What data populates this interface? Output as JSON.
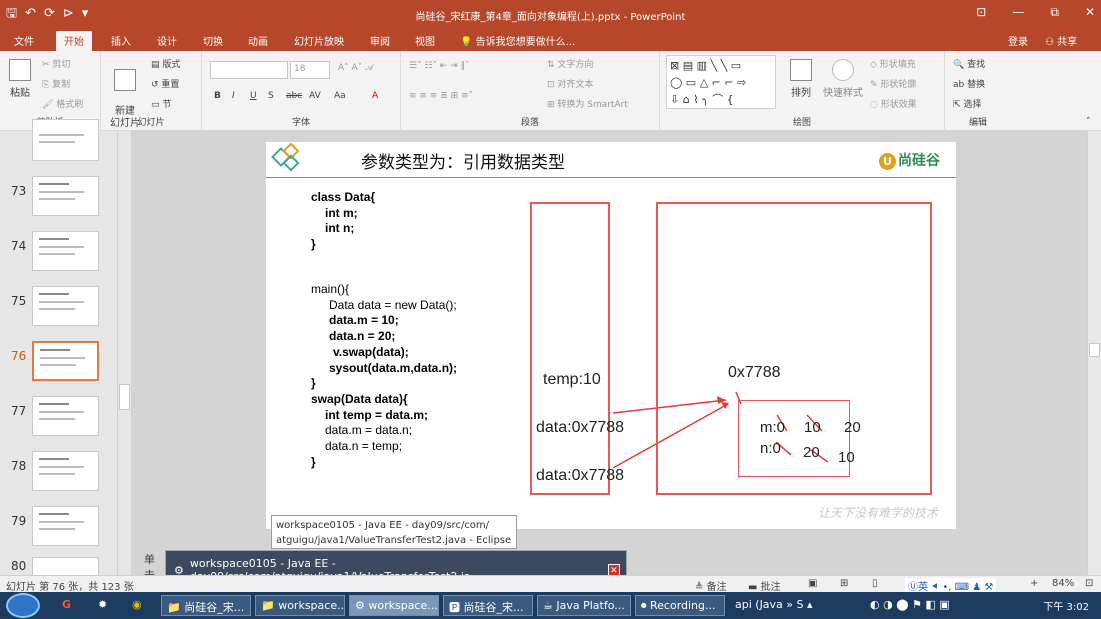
{
  "titlebar": {
    "qat": [
      "🖫",
      "↶",
      "⟳",
      "⊳",
      "▾"
    ],
    "title": "尚硅谷_宋红康_第4章_面向对象编程(上).pptx - PowerPoint",
    "win_controls": [
      "⊡",
      "—",
      "⧉",
      "✕"
    ]
  },
  "tabs": [
    "文件",
    "开始",
    "插入",
    "设计",
    "切换",
    "动画",
    "幻灯片放映",
    "审阅",
    "视图"
  ],
  "tellme": "告诉我您想要做什么...",
  "login": "登录",
  "share": "共享",
  "ribbon": {
    "clipboard": {
      "label": "剪贴板",
      "paste": "粘贴",
      "cut": "剪切",
      "copy": "复制",
      "format_painter": "格式刷"
    },
    "slides": {
      "label": "幻灯片",
      "new_slide": "新建\n幻灯片",
      "layout": "版式",
      "reset": "重置",
      "section": "节"
    },
    "font": {
      "label": "字体",
      "font_name": "",
      "font_size": "18",
      "buttons": [
        "B",
        "I",
        "U",
        "S",
        "abc",
        "AV",
        "Aa",
        "A"
      ]
    },
    "paragraph": {
      "label": "段落",
      "text_direction": "文字方向",
      "align_text": "对齐文本",
      "smartart": "转换为 SmartArt"
    },
    "drawing": {
      "label": "绘图",
      "arrange": "排列",
      "quick_styles": "快速样式",
      "shape_fill": "形状填充",
      "shape_outline": "形状轮廓",
      "shape_effects": "形状效果"
    },
    "editing": {
      "label": "编辑",
      "find": "查找",
      "replace": "替换",
      "select": "选择"
    }
  },
  "thumbnails": [
    {
      "num": "",
      "active": false
    },
    {
      "num": "73",
      "active": false
    },
    {
      "num": "74",
      "active": false
    },
    {
      "num": "75",
      "active": false
    },
    {
      "num": "76",
      "active": true
    },
    {
      "num": "77",
      "active": false
    },
    {
      "num": "78",
      "active": false
    },
    {
      "num": "79",
      "active": false
    },
    {
      "num": "80",
      "active": false
    }
  ],
  "slide": {
    "title": "参数类型为：引用数据类型",
    "brand": "尚硅谷",
    "code_class": [
      "class Data{",
      "    int m;",
      "    int n;",
      "}"
    ],
    "code_main": [
      "main(){",
      "    Data data = new Data();",
      "    data.m = 10;",
      "    data.n = 20;",
      "     v.swap(data);",
      "    sysout(data.m,data.n);",
      "}",
      "swap(Data data){",
      "    int temp = data.m;",
      "    data.m = data.n;",
      "    data.n = temp;",
      "}"
    ],
    "stack_labels": {
      "temp": "temp:10",
      "data1": "data:0x7788",
      "data2": "data:0x7788"
    },
    "heap": {
      "addr": "0x7788",
      "m_label": "m:0",
      "m_vals": [
        "10",
        "20"
      ],
      "n_label": "n:0",
      "n_vals": [
        "20",
        "10"
      ]
    },
    "watermark": "让天下没有难学的技术"
  },
  "tooltip": "workspace0105 - Java EE - day09/src/com/\natguigu/java1/ValueTransferTest2.java - Eclipse",
  "notes_hint": "单击",
  "task_preview": "workspace0105 - Java EE - day09/src/com/atguigu/java1/ValueTransferTest2.ja...",
  "statusbar": {
    "slide_info": "幻灯片 第 76 张，共 123 张",
    "notes": "备注",
    "comments": "批注",
    "zoom": "84%"
  },
  "taskbar": {
    "items": [
      "尚硅谷_宋...",
      "workspace...",
      "workspace...",
      "尚硅谷_宋...",
      "Java Platfo...",
      "Recording..."
    ],
    "active_index": 2,
    "tray": "api  (Java »  S  ▴",
    "clock": "下午 3:02"
  }
}
